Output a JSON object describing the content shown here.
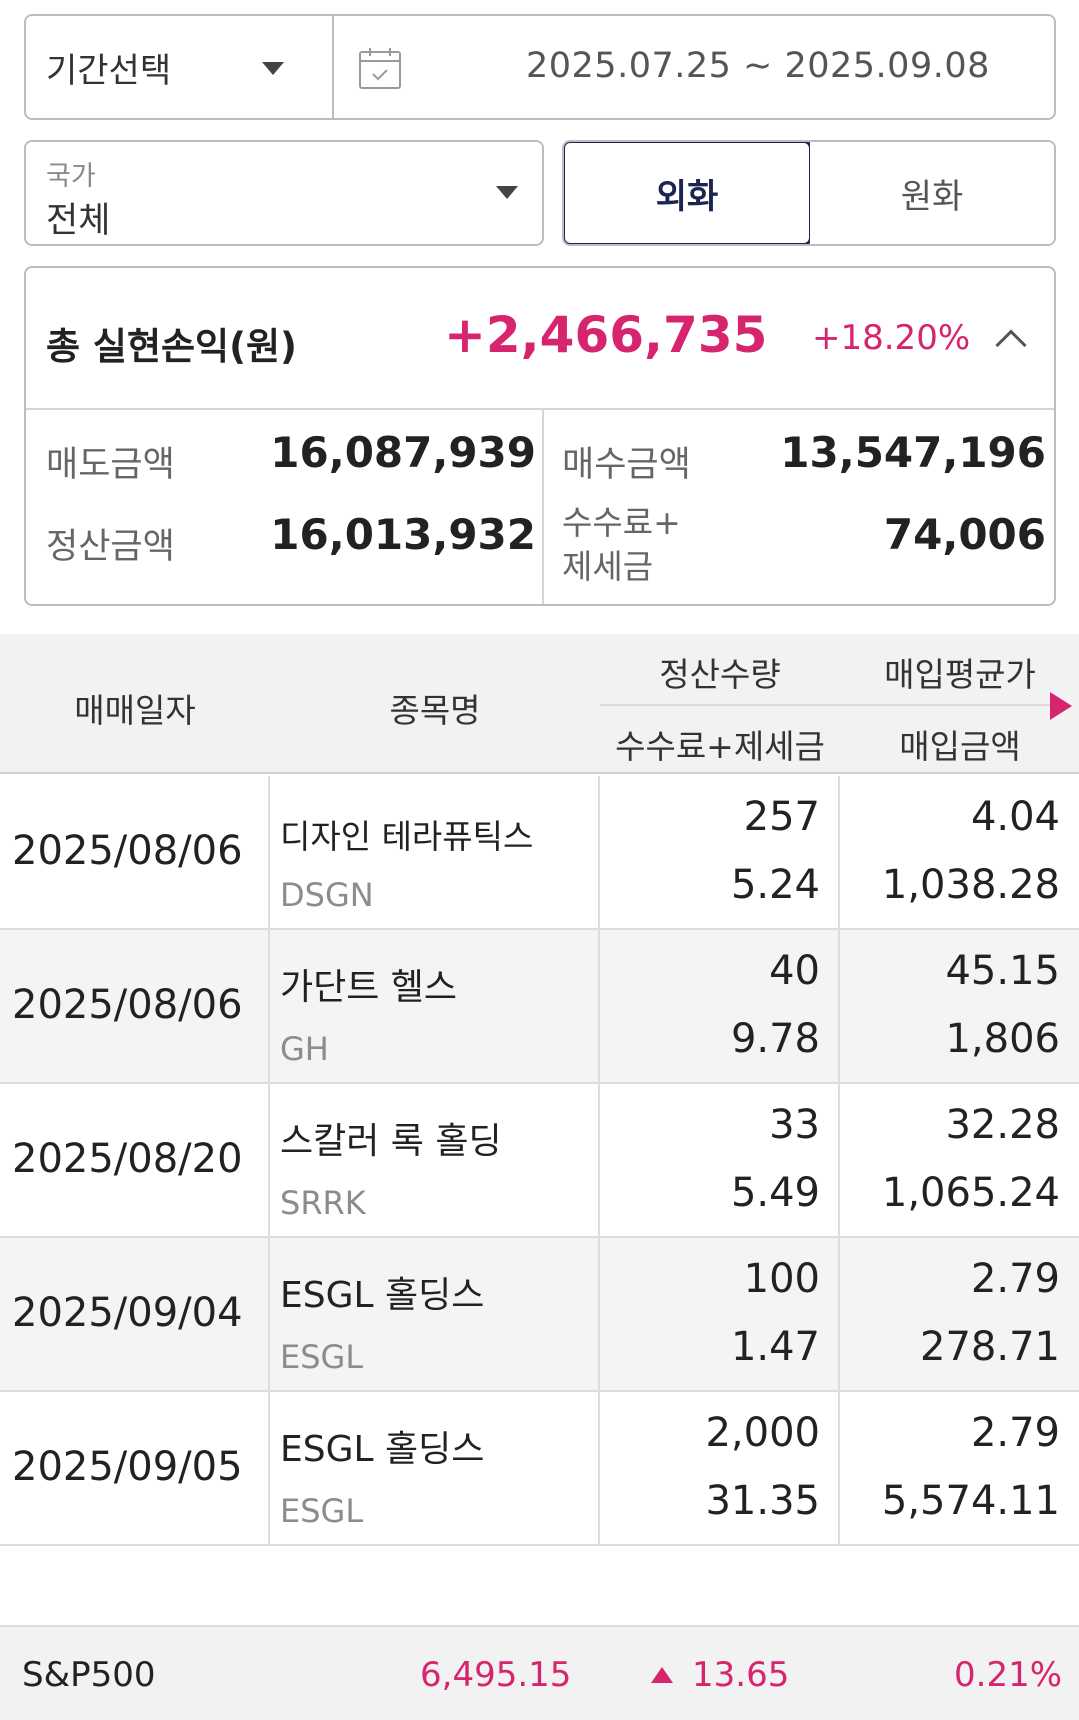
{
  "period": {
    "select_label": "기간선택",
    "date_range": "2025.07.25 ~ 2025.09.08"
  },
  "country": {
    "label": "국가",
    "value": "전체"
  },
  "currency_toggle": {
    "options": [
      "외화",
      "원화"
    ],
    "selected": "외화"
  },
  "summary": {
    "title": "총 실현손익(원)",
    "amount": "+2,466,735",
    "percent": "+18.20%",
    "sell_label": "매도금액",
    "sell_value": "16,087,939",
    "buy_label": "매수금액",
    "buy_value": "13,547,196",
    "settle_label": "정산금액",
    "settle_value": "16,013,932",
    "fee_label_1": "수수료+",
    "fee_label_2": "제세금",
    "fee_value": "74,006"
  },
  "table": {
    "headers": {
      "date": "매매일자",
      "name": "종목명",
      "qty": "정산수량",
      "fee": "수수료+제세금",
      "avg_price": "매입평균가",
      "buy_amount": "매입금액"
    },
    "rows": [
      {
        "date": "2025/08/06",
        "name": "디자인 테라퓨틱스",
        "ticker": "DSGN",
        "qty": "257",
        "fee": "5.24",
        "avg_price": "4.04",
        "buy_amount": "1,038.28"
      },
      {
        "date": "2025/08/06",
        "name": "가단트 헬스",
        "ticker": "GH",
        "qty": "40",
        "fee": "9.78",
        "avg_price": "45.15",
        "buy_amount": "1,806"
      },
      {
        "date": "2025/08/20",
        "name": "스칼러 록 홀딩",
        "ticker": "SRRK",
        "qty": "33",
        "fee": "5.49",
        "avg_price": "32.28",
        "buy_amount": "1,065.24"
      },
      {
        "date": "2025/09/04",
        "name": "ESGL 홀딩스",
        "ticker": "ESGL",
        "qty": "100",
        "fee": "1.47",
        "avg_price": "2.79",
        "buy_amount": "278.71"
      },
      {
        "date": "2025/09/05",
        "name": "ESGL 홀딩스",
        "ticker": "ESGL",
        "qty": "2,000",
        "fee": "31.35",
        "avg_price": "2.79",
        "buy_amount": "5,574.11"
      }
    ]
  },
  "index_ticker": {
    "name": "S&P500",
    "price": "6,495.15",
    "change": "13.65",
    "change_pct": "0.21%",
    "direction": "up",
    "color": "#d6246e"
  },
  "colors": {
    "accent": "#d6246e",
    "navy": "#1c2452",
    "border": "#bdbdbd"
  }
}
